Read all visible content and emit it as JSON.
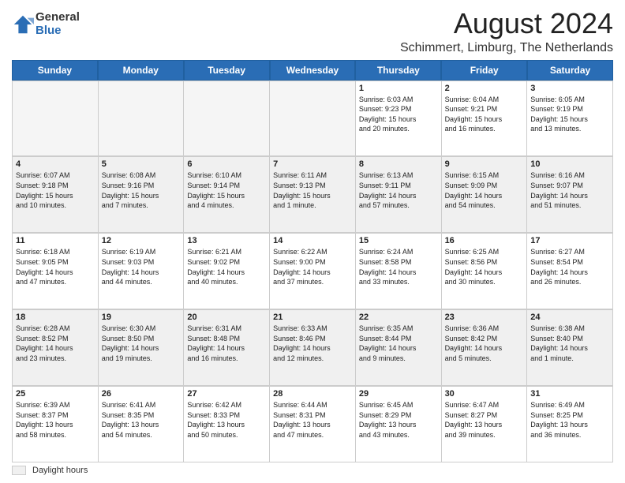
{
  "logo": {
    "general": "General",
    "blue": "Blue"
  },
  "title": {
    "month_year": "August 2024",
    "location": "Schimmert, Limburg, The Netherlands"
  },
  "headers": [
    "Sunday",
    "Monday",
    "Tuesday",
    "Wednesday",
    "Thursday",
    "Friday",
    "Saturday"
  ],
  "weeks": [
    [
      {
        "day": "",
        "info": "",
        "empty": true
      },
      {
        "day": "",
        "info": "",
        "empty": true
      },
      {
        "day": "",
        "info": "",
        "empty": true
      },
      {
        "day": "",
        "info": "",
        "empty": true
      },
      {
        "day": "1",
        "info": "Sunrise: 6:03 AM\nSunset: 9:23 PM\nDaylight: 15 hours\nand 20 minutes."
      },
      {
        "day": "2",
        "info": "Sunrise: 6:04 AM\nSunset: 9:21 PM\nDaylight: 15 hours\nand 16 minutes."
      },
      {
        "day": "3",
        "info": "Sunrise: 6:05 AM\nSunset: 9:19 PM\nDaylight: 15 hours\nand 13 minutes."
      }
    ],
    [
      {
        "day": "4",
        "info": "Sunrise: 6:07 AM\nSunset: 9:18 PM\nDaylight: 15 hours\nand 10 minutes."
      },
      {
        "day": "5",
        "info": "Sunrise: 6:08 AM\nSunset: 9:16 PM\nDaylight: 15 hours\nand 7 minutes."
      },
      {
        "day": "6",
        "info": "Sunrise: 6:10 AM\nSunset: 9:14 PM\nDaylight: 15 hours\nand 4 minutes."
      },
      {
        "day": "7",
        "info": "Sunrise: 6:11 AM\nSunset: 9:13 PM\nDaylight: 15 hours\nand 1 minute."
      },
      {
        "day": "8",
        "info": "Sunrise: 6:13 AM\nSunset: 9:11 PM\nDaylight: 14 hours\nand 57 minutes."
      },
      {
        "day": "9",
        "info": "Sunrise: 6:15 AM\nSunset: 9:09 PM\nDaylight: 14 hours\nand 54 minutes."
      },
      {
        "day": "10",
        "info": "Sunrise: 6:16 AM\nSunset: 9:07 PM\nDaylight: 14 hours\nand 51 minutes."
      }
    ],
    [
      {
        "day": "11",
        "info": "Sunrise: 6:18 AM\nSunset: 9:05 PM\nDaylight: 14 hours\nand 47 minutes."
      },
      {
        "day": "12",
        "info": "Sunrise: 6:19 AM\nSunset: 9:03 PM\nDaylight: 14 hours\nand 44 minutes."
      },
      {
        "day": "13",
        "info": "Sunrise: 6:21 AM\nSunset: 9:02 PM\nDaylight: 14 hours\nand 40 minutes."
      },
      {
        "day": "14",
        "info": "Sunrise: 6:22 AM\nSunset: 9:00 PM\nDaylight: 14 hours\nand 37 minutes."
      },
      {
        "day": "15",
        "info": "Sunrise: 6:24 AM\nSunset: 8:58 PM\nDaylight: 14 hours\nand 33 minutes."
      },
      {
        "day": "16",
        "info": "Sunrise: 6:25 AM\nSunset: 8:56 PM\nDaylight: 14 hours\nand 30 minutes."
      },
      {
        "day": "17",
        "info": "Sunrise: 6:27 AM\nSunset: 8:54 PM\nDaylight: 14 hours\nand 26 minutes."
      }
    ],
    [
      {
        "day": "18",
        "info": "Sunrise: 6:28 AM\nSunset: 8:52 PM\nDaylight: 14 hours\nand 23 minutes."
      },
      {
        "day": "19",
        "info": "Sunrise: 6:30 AM\nSunset: 8:50 PM\nDaylight: 14 hours\nand 19 minutes."
      },
      {
        "day": "20",
        "info": "Sunrise: 6:31 AM\nSunset: 8:48 PM\nDaylight: 14 hours\nand 16 minutes."
      },
      {
        "day": "21",
        "info": "Sunrise: 6:33 AM\nSunset: 8:46 PM\nDaylight: 14 hours\nand 12 minutes."
      },
      {
        "day": "22",
        "info": "Sunrise: 6:35 AM\nSunset: 8:44 PM\nDaylight: 14 hours\nand 9 minutes."
      },
      {
        "day": "23",
        "info": "Sunrise: 6:36 AM\nSunset: 8:42 PM\nDaylight: 14 hours\nand 5 minutes."
      },
      {
        "day": "24",
        "info": "Sunrise: 6:38 AM\nSunset: 8:40 PM\nDaylight: 14 hours\nand 1 minute."
      }
    ],
    [
      {
        "day": "25",
        "info": "Sunrise: 6:39 AM\nSunset: 8:37 PM\nDaylight: 13 hours\nand 58 minutes."
      },
      {
        "day": "26",
        "info": "Sunrise: 6:41 AM\nSunset: 8:35 PM\nDaylight: 13 hours\nand 54 minutes."
      },
      {
        "day": "27",
        "info": "Sunrise: 6:42 AM\nSunset: 8:33 PM\nDaylight: 13 hours\nand 50 minutes."
      },
      {
        "day": "28",
        "info": "Sunrise: 6:44 AM\nSunset: 8:31 PM\nDaylight: 13 hours\nand 47 minutes."
      },
      {
        "day": "29",
        "info": "Sunrise: 6:45 AM\nSunset: 8:29 PM\nDaylight: 13 hours\nand 43 minutes."
      },
      {
        "day": "30",
        "info": "Sunrise: 6:47 AM\nSunset: 8:27 PM\nDaylight: 13 hours\nand 39 minutes."
      },
      {
        "day": "31",
        "info": "Sunrise: 6:49 AM\nSunset: 8:25 PM\nDaylight: 13 hours\nand 36 minutes."
      }
    ]
  ],
  "legend": {
    "label": "Daylight hours"
  }
}
